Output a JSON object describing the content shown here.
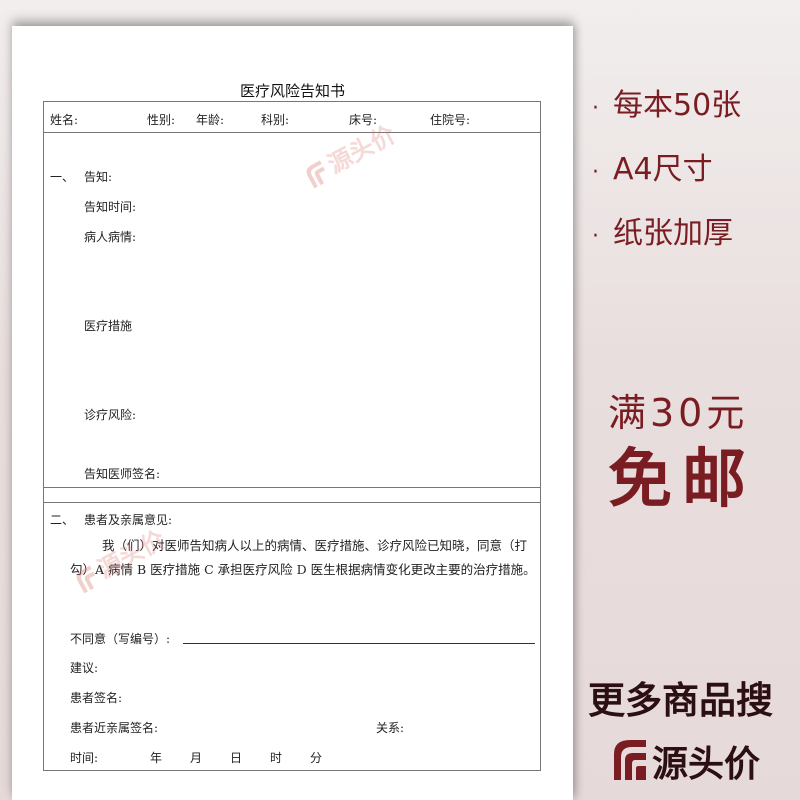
{
  "form": {
    "title": "医疗风险告知书",
    "header": {
      "name": "姓名:",
      "gender": "性别:",
      "age": "年龄:",
      "department": "科别:",
      "bed": "床号:",
      "admission": "住院号:"
    },
    "section1": {
      "number": "一、",
      "title": "告知:",
      "notify_time": "告知时间:",
      "condition": "病人病情:",
      "measures": "医疗措施",
      "risks": "诊疗风险:",
      "doctor_sign": "告知医师签名:"
    },
    "section2": {
      "number": "二、",
      "title": "患者及亲属意见:",
      "statement": "我（们）对医师告知病人以上的病情、医疗措施、诊疗风险已知晓，同意（打勾）A 病情 B 医疗措施 C 承担医疗风险 D 医生根据病情变化更改主要的治疗措施。",
      "disagree": "不同意（写编号）:",
      "suggestion": "建议:",
      "patient_sign": "患者签名:",
      "relative_sign": "患者近亲属签名:",
      "relation": "关系:",
      "time": "时间:",
      "year": "年",
      "month": "月",
      "day": "日",
      "hour": "时",
      "minute": "分"
    }
  },
  "watermark": "源头价",
  "features": [
    "每本50张",
    "A4尺寸",
    "纸张加厚"
  ],
  "feature_bullet": "·",
  "promo": {
    "line1": "满30元",
    "line2": "免邮"
  },
  "more_label": "更多商品搜",
  "brand": "源头价",
  "colors": {
    "accent": "#7a1d22",
    "dark": "#2b0f12",
    "watermark": "#d6786e",
    "border": "#777777"
  },
  "icons": {
    "brand_logo": "stacked-arches-logo"
  }
}
